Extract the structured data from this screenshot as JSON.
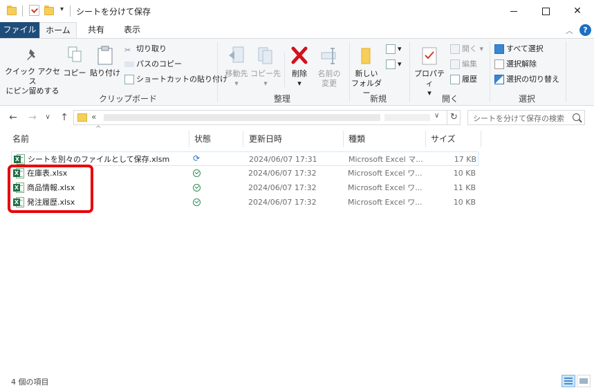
{
  "window": {
    "title": "シートを分けて保存",
    "controls": {
      "minimize": "–",
      "maximize": "☐",
      "close": "✕"
    }
  },
  "ribbon_tabs": [
    {
      "label": "ファイル"
    },
    {
      "label": "ホーム"
    },
    {
      "label": "共有"
    },
    {
      "label": "表示"
    }
  ],
  "ribbon": {
    "clipboard": {
      "pin_label_1": "クイック アクセス",
      "pin_label_2": "にピン留めする",
      "copy": "コピー",
      "paste": "貼り付け",
      "cut": "切り取り",
      "copy_path": "パスのコピー",
      "paste_shortcut": "ショートカットの貼り付け",
      "group": "クリップボード"
    },
    "organize": {
      "move_to": "移動先",
      "copy_to": "コピー先",
      "delete": "削除",
      "rename_1": "名前の",
      "rename_2": "変更",
      "group": "整理"
    },
    "new": {
      "new_folder_1": "新しい",
      "new_folder_2": "フォルダー",
      "group": "新規"
    },
    "open": {
      "properties": "プロパティ",
      "open": "開く",
      "edit": "編集",
      "history": "履歴",
      "group": "開く"
    },
    "select": {
      "select_all": "すべて選択",
      "select_none": "選択解除",
      "invert": "選択の切り替え",
      "group": "選択"
    }
  },
  "address": {
    "prefix": "«",
    "search_placeholder": "シートを分けて保存の検索"
  },
  "columns": {
    "name": "名前",
    "status": "状態",
    "modified": "更新日時",
    "type": "種類",
    "size": "サイズ"
  },
  "files": [
    {
      "name": "シートを別々のファイルとして保存.xlsm",
      "status": "sync",
      "modified": "2024/06/07 17:31",
      "type": "Microsoft Excel マ...",
      "size": "17 KB"
    },
    {
      "name": "在庫表.xlsx",
      "status": "ok",
      "modified": "2024/06/07 17:32",
      "type": "Microsoft Excel ワ...",
      "size": "10 KB"
    },
    {
      "name": "商品情報.xlsx",
      "status": "ok",
      "modified": "2024/06/07 17:32",
      "type": "Microsoft Excel ワ...",
      "size": "11 KB"
    },
    {
      "name": "発注履歴.xlsx",
      "status": "ok",
      "modified": "2024/06/07 17:32",
      "type": "Microsoft Excel ワ...",
      "size": "10 KB"
    }
  ],
  "statusbar": {
    "item_count": "4 個の項目"
  },
  "colors": {
    "file_tab": "#1f4d7a",
    "highlight": "#e8000b",
    "excel_green": "#1e7145",
    "accent_blue": "#1d6fc4"
  }
}
